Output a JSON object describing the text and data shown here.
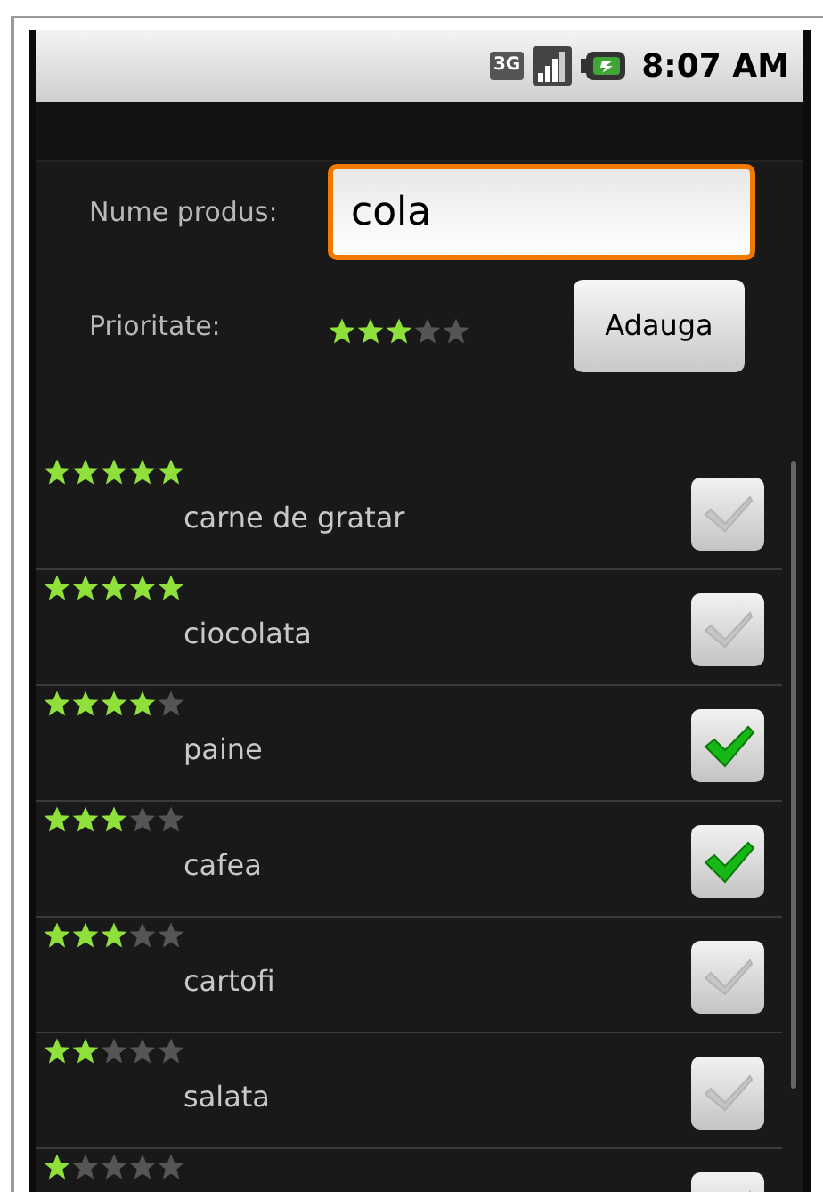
{
  "status_bar": {
    "network": "3G",
    "time": "8:07 AM"
  },
  "form": {
    "name_label": "Nume produs:",
    "name_field": {
      "value": "cola",
      "focused": true
    },
    "priority_label": "Prioritate:",
    "priority": {
      "stars": 3
    },
    "add_button": "Adauga"
  },
  "items": [
    {
      "name": "carne de gratar",
      "stars": 5,
      "checked": false
    },
    {
      "name": "ciocolata",
      "stars": 5,
      "checked": false
    },
    {
      "name": "paine",
      "stars": 4,
      "checked": true
    },
    {
      "name": "cafea",
      "stars": 3,
      "checked": true
    },
    {
      "name": "cartofi",
      "stars": 3,
      "checked": false
    },
    {
      "name": "salata",
      "stars": 2,
      "checked": false
    },
    {
      "stars": 1,
      "checked": false
    }
  ]
}
